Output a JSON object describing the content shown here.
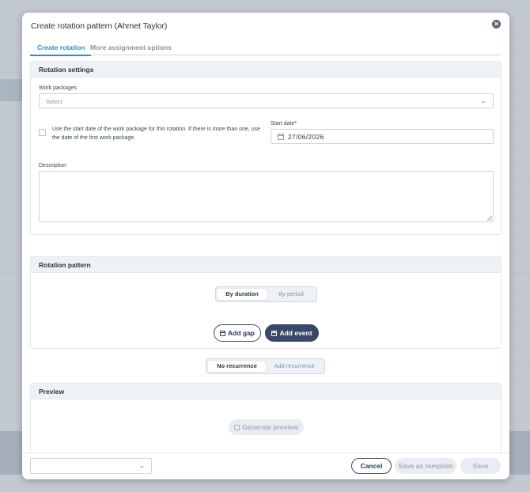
{
  "modal": {
    "title": "Create rotation pattern (Ahmet Taylor)"
  },
  "tabs": [
    {
      "label": "Create rotation",
      "active": true
    },
    {
      "label": "More assignment options",
      "active": false
    }
  ],
  "rotation_settings": {
    "heading": "Rotation settings",
    "work_packages_label": "Work packages",
    "work_packages_placeholder": "Select",
    "use_start_date_text": "Use the start date of the work package for this rotation. If there is more than one, use the date of the first work package.",
    "start_date_label": "Start date*",
    "start_date_value": "27/06/2026",
    "description_label": "Description",
    "description_value": ""
  },
  "rotation_pattern": {
    "heading": "Rotation pattern",
    "mode_options": [
      "By duration",
      "By period"
    ],
    "mode_selected": "By duration",
    "add_gap_label": "Add gap",
    "add_event_label": "Add event"
  },
  "recurrence": {
    "options": [
      "No recurrence",
      "Add recurrence"
    ],
    "selected": "No recurrence"
  },
  "preview": {
    "heading": "Preview",
    "generate_label": "Generate preview"
  },
  "footer": {
    "template_select_value": "",
    "cancel_label": "Cancel",
    "save_as_template_label": "Save as template",
    "save_label": "Save"
  },
  "icons": {
    "close": "close-icon",
    "dropdown": "chevron-down-icon",
    "calendar": "calendar-icon",
    "add_event": "calendar-plus-icon",
    "preview": "preview-icon"
  },
  "colors": {
    "accent": "#2f8fc9",
    "primary_button": "#3a4868",
    "section_header_bg": "#eef1f5"
  }
}
